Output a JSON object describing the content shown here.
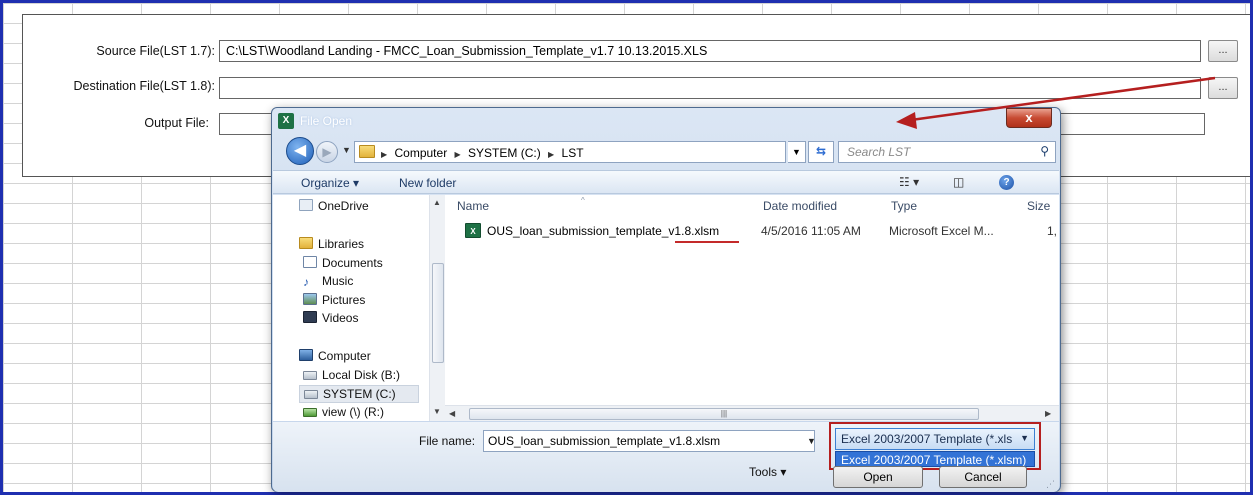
{
  "form": {
    "source_label": "Source File(LST 1.7):",
    "source_value": "C:\\LST\\Woodland Landing - FMCC_Loan_Submission_Template_v1.7 10.13.2015.XLS",
    "destination_label": "Destination File(LST 1.8):",
    "destination_value": "",
    "output_label": "Output File:",
    "output_value": "",
    "browse_label": "..."
  },
  "dialog": {
    "app_icon": "excel-icon",
    "title": "File Open",
    "close_label": "x",
    "breadcrumb": [
      "Computer",
      "SYSTEM (C:)",
      "LST"
    ],
    "search_placeholder": "Search LST",
    "toolbar": {
      "organize": "Organize ▾",
      "new_folder": "New folder"
    },
    "nav_items": [
      {
        "label": "OneDrive",
        "icon": "onedrive-icon"
      },
      {
        "label": "Libraries",
        "icon": "libraries-icon"
      },
      {
        "label": "Documents",
        "icon": "documents-icon"
      },
      {
        "label": "Music",
        "icon": "music-icon"
      },
      {
        "label": "Pictures",
        "icon": "pictures-icon"
      },
      {
        "label": "Videos",
        "icon": "videos-icon"
      },
      {
        "label": "Computer",
        "icon": "computer-icon"
      },
      {
        "label": "Local Disk (B:)",
        "icon": "disk-icon"
      },
      {
        "label": "SYSTEM (C:)",
        "icon": "disk-icon"
      },
      {
        "label": "view (\\) (R:)",
        "icon": "network-drive-icon"
      }
    ],
    "columns": {
      "name": "Name",
      "date": "Date modified",
      "type": "Type",
      "size": "Size"
    },
    "files": [
      {
        "name": "OUS_loan_submission_template_v1.8.xlsm",
        "date": "4/5/2016 11:05 AM",
        "type": "Microsoft Excel M...",
        "size": "1,"
      }
    ],
    "file_name_label": "File name:",
    "file_name_value": "OUS_loan_submission_template_v1.8.xlsm",
    "filter_selected": "Excel 2003/2007 Template (*.xls",
    "filter_option": "Excel 2003/2007 Template (*.xlsm)",
    "tools_label": "Tools ▾",
    "open_label": "Open",
    "cancel_label": "Cancel"
  },
  "colors": {
    "frame_border": "#1f2fb0",
    "annotation_red": "#b51f1f",
    "selection_blue": "#3373d6"
  }
}
